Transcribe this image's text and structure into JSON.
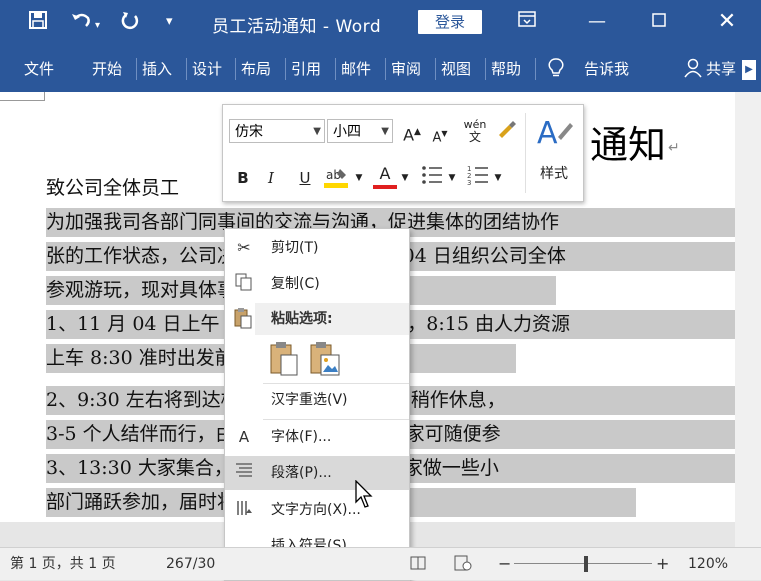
{
  "titlebar": {
    "title": "员工活动通知 - Word",
    "login_label": "登录"
  },
  "ribbon": {
    "tabs": [
      "文件",
      "开始",
      "插入",
      "设计",
      "布局",
      "引用",
      "邮件",
      "审阅",
      "视图",
      "帮助"
    ],
    "tell_me": "告诉我",
    "share": "共享"
  },
  "document": {
    "heading_partial": "通知",
    "greeting": "致公司全体员工",
    "lines": [
      "为加强我司各部门同事间的交流与沟通，促进集体的团结协作",
      "张的工作状态，公司决定于 2019 年 8 月 04 日组织公司全体",
      "参观游玩，现对具体事宜作如下安排：",
      "1、11 月 04 日上午 8:00 在公司门口集合，8:15 由人力资源",
      "上车 8:30 准时出发前往植物园。",
      "2、9:30 左右将到达植物园，下车后大家可稍作休息，",
      "3-5 个人结伴而行，由于门票为通票所以大家可随便参",
      "3、13:30 大家集合，人力资源部会组织大家做一些小",
      "部门踊跃参加，届时将有精美礼品赠送。"
    ]
  },
  "minitoolbar": {
    "font_name": "仿宋",
    "font_size": "小四",
    "styles_label": "样式",
    "grow_font": "A",
    "shrink_font": "A",
    "phonetic": "wén",
    "bold": "B",
    "italic": "I",
    "underline": "U",
    "font_color": "A"
  },
  "context_menu": {
    "cut": "剪切(T)",
    "copy": "复制(C)",
    "paste_options": "粘贴选项:",
    "reconversion": "汉字重选(V)",
    "font": "字体(F)...",
    "paragraph": "段落(P)...",
    "text_direction": "文字方向(X)...",
    "insert_symbol": "插入符号(S)"
  },
  "statusbar": {
    "page_info": "第 1 页，共 1 页",
    "word_count": "267/30",
    "zoom": "120%"
  },
  "colors": {
    "brand": "#2b579a",
    "selection": "#c9c9c9",
    "highlight_yellow": "#ffd700",
    "font_red": "#e02020"
  }
}
